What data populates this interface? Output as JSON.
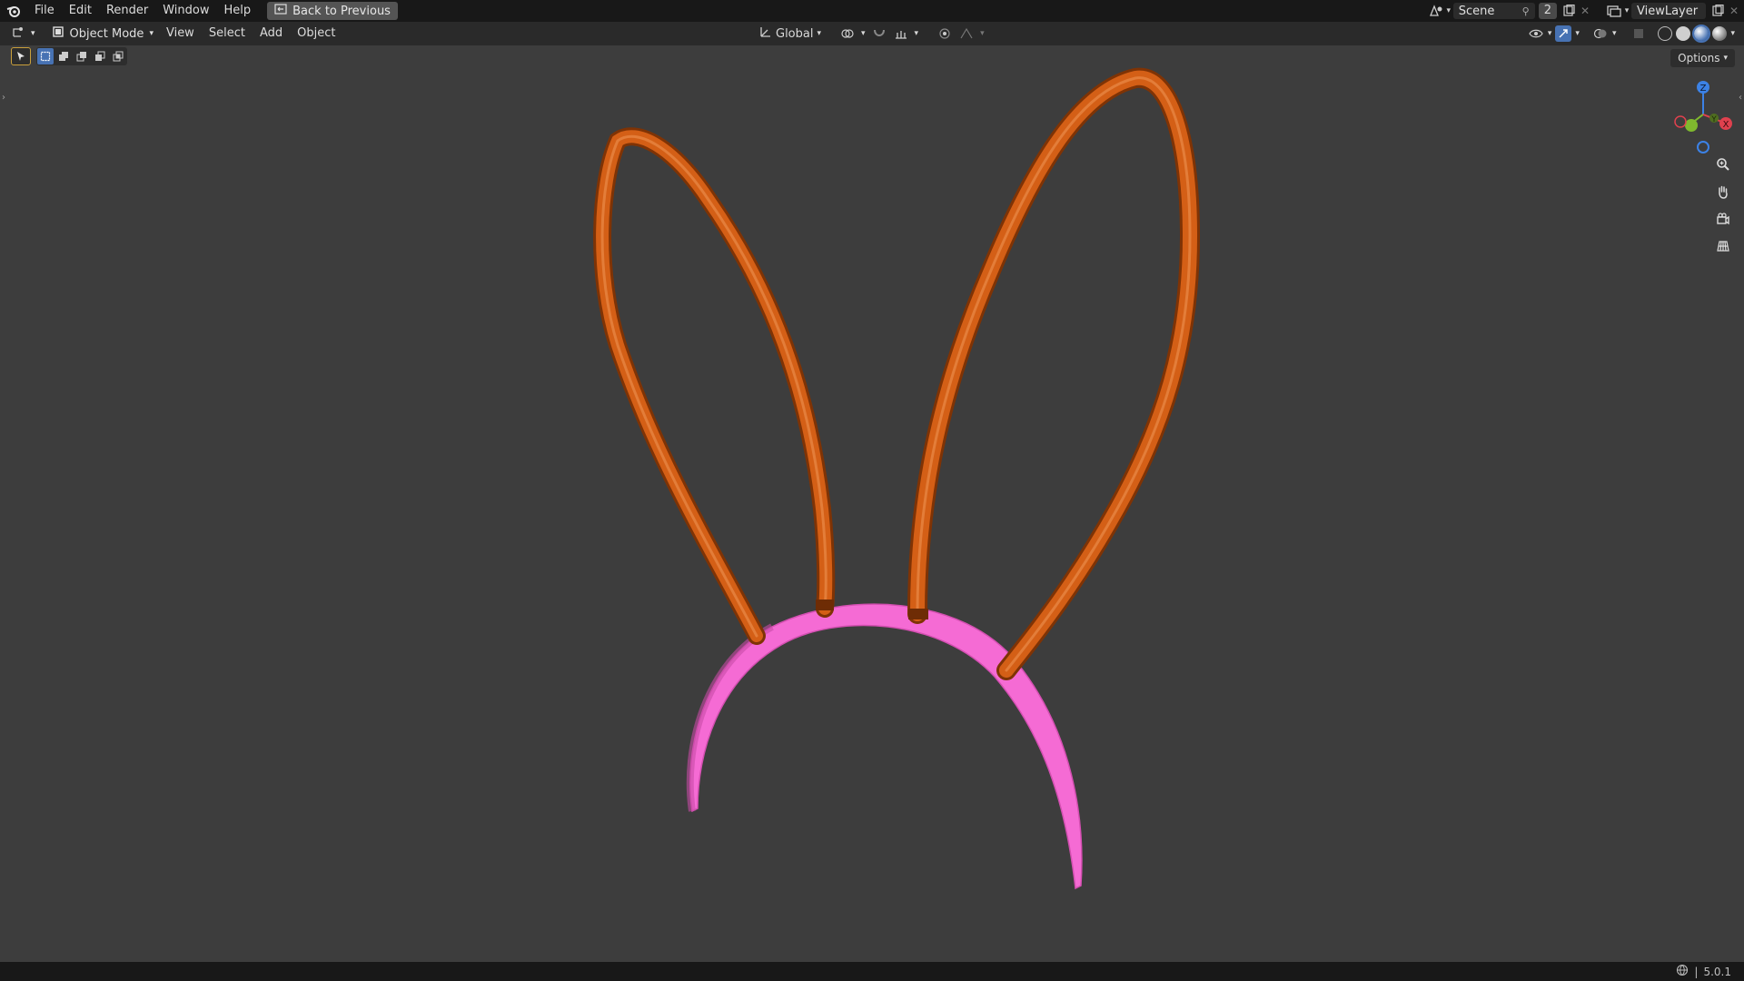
{
  "menubar": {
    "logo_icon": "blender-logo-icon",
    "items": [
      "File",
      "Edit",
      "Render",
      "Window",
      "Help"
    ],
    "back_button": "Back to Previous"
  },
  "scene": {
    "name": "Scene",
    "users": "2"
  },
  "view_layer": {
    "name": "ViewLayer"
  },
  "header": {
    "mode": "Object Mode",
    "menus": [
      "View",
      "Select",
      "Add",
      "Object"
    ],
    "orientation": "Global"
  },
  "viewport": {
    "options_label": "Options",
    "gizmo": {
      "z": "Z",
      "y": "Y",
      "x": "X"
    },
    "colors": {
      "background": "#3d3d3d",
      "ears": "#c4530f",
      "headband": "#f56bd4",
      "axis_x": "#e0414e",
      "axis_y": "#7fb92e",
      "axis_z": "#3c82e6"
    }
  },
  "status": {
    "version": "5.0.1"
  }
}
